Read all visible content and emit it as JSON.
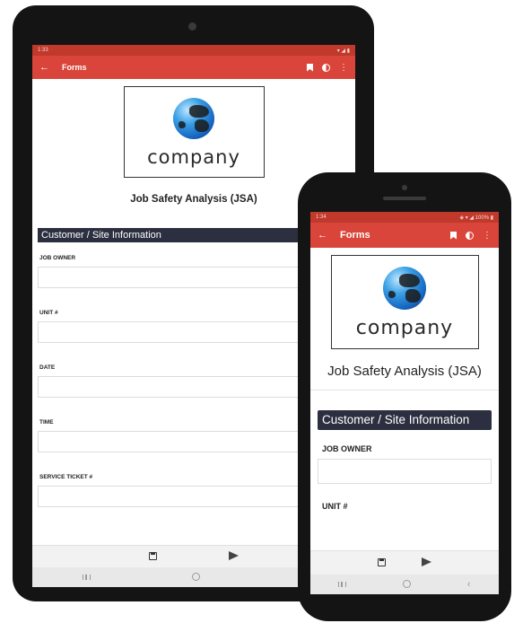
{
  "tablet": {
    "status": {
      "time": "1:33",
      "icons": "▾ ◢ ▮"
    },
    "appbar": {
      "title": "Forms"
    },
    "logo": {
      "text": "company"
    },
    "form_title": "Job Safety Analysis (JSA)",
    "section_header": "Customer / Site Information",
    "fields": [
      "JOB OWNER",
      "UNIT #",
      "DATE",
      "TIME",
      "SERVICE TICKET #"
    ]
  },
  "phone": {
    "status": {
      "time": "1:34",
      "icons": "◈ ▾ ◢ 100% ▮"
    },
    "appbar": {
      "title": "Forms"
    },
    "logo": {
      "text": "company"
    },
    "form_title": "Job Safety Analysis (JSA)",
    "section_header": "Customer / Site Information",
    "fields": [
      "JOB OWNER",
      "UNIT #"
    ]
  },
  "icons": {
    "back": "arrow-back-icon",
    "bookmark": "bookmark-icon",
    "contrast": "contrast-icon",
    "more": "more-vert-icon",
    "save": "save-icon",
    "send": "send-icon"
  },
  "colors": {
    "appbar": "#d9453a",
    "statusbar": "#c0392b",
    "section_header_bg": "#2c2f3f"
  }
}
